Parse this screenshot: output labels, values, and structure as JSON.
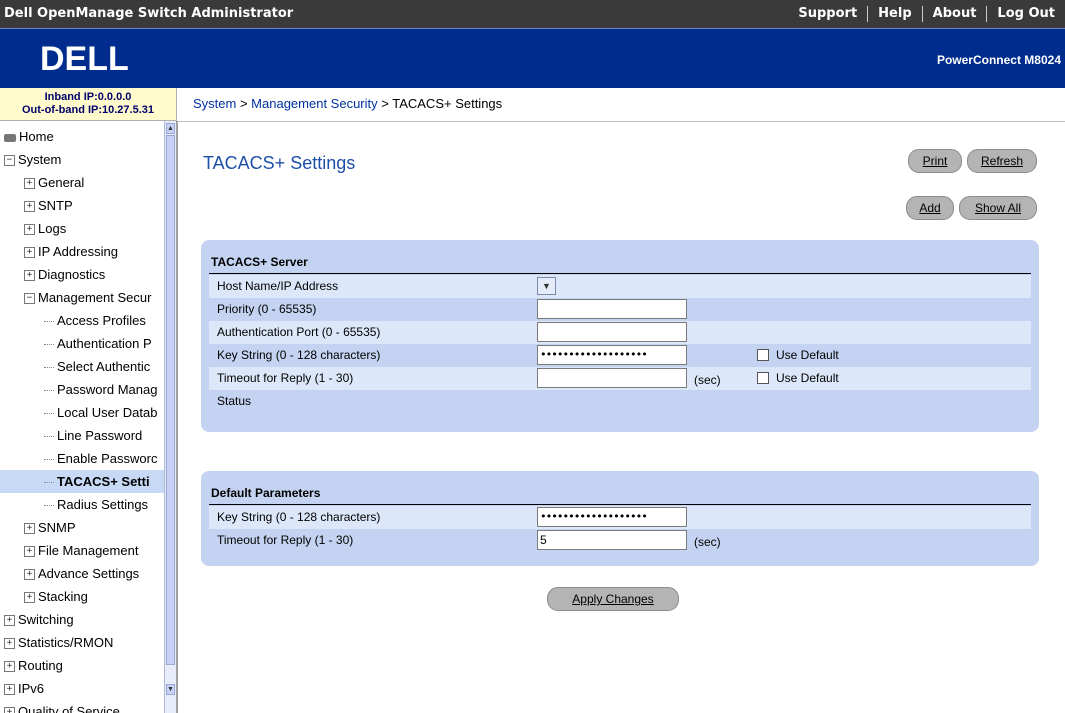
{
  "topbar": {
    "app_title": "Dell OpenManage Switch Administrator",
    "links": [
      "Support",
      "Help",
      "About",
      "Log Out"
    ]
  },
  "banner": {
    "logo_text": "DELL",
    "product": "PowerConnect M8024"
  },
  "ip_info": {
    "inband": "Inband IP:0.0.0.0",
    "out_of_band": "Out-of-band IP:10.27.5.31"
  },
  "breadcrumb": {
    "system": "System",
    "sep1": " > ",
    "mgmt": "Management Security",
    "sep2": " > ",
    "current": "TACACS+ Settings"
  },
  "sidebar": {
    "items": [
      {
        "label": "Home",
        "level": 0,
        "type": "home"
      },
      {
        "label": "System",
        "level": 0,
        "type": "minus"
      },
      {
        "label": "General",
        "level": 1,
        "type": "plus"
      },
      {
        "label": "SNTP",
        "level": 1,
        "type": "plus"
      },
      {
        "label": "Logs",
        "level": 1,
        "type": "plus"
      },
      {
        "label": "IP Addressing",
        "level": 1,
        "type": "plus"
      },
      {
        "label": "Diagnostics",
        "level": 1,
        "type": "plus"
      },
      {
        "label": "Management Secur",
        "level": 1,
        "type": "minus"
      },
      {
        "label": "Access Profiles",
        "level": 2,
        "type": "leaf"
      },
      {
        "label": "Authentication P",
        "level": 2,
        "type": "leaf"
      },
      {
        "label": "Select Authentic",
        "level": 2,
        "type": "leaf"
      },
      {
        "label": "Password Manag",
        "level": 2,
        "type": "leaf"
      },
      {
        "label": "Local User Datab",
        "level": 2,
        "type": "leaf"
      },
      {
        "label": "Line Password",
        "level": 2,
        "type": "leaf"
      },
      {
        "label": "Enable Passworc",
        "level": 2,
        "type": "leaf"
      },
      {
        "label": "TACACS+ Setti",
        "level": 2,
        "type": "leaf",
        "selected": true
      },
      {
        "label": "Radius Settings",
        "level": 2,
        "type": "leaf"
      },
      {
        "label": "SNMP",
        "level": 1,
        "type": "plus"
      },
      {
        "label": "File Management",
        "level": 1,
        "type": "plus"
      },
      {
        "label": "Advance Settings",
        "level": 1,
        "type": "plus"
      },
      {
        "label": "Stacking",
        "level": 1,
        "type": "plus"
      },
      {
        "label": "Switching",
        "level": 0,
        "type": "plus"
      },
      {
        "label": "Statistics/RMON",
        "level": 0,
        "type": "plus"
      },
      {
        "label": "Routing",
        "level": 0,
        "type": "plus"
      },
      {
        "label": "IPv6",
        "level": 0,
        "type": "plus"
      },
      {
        "label": "Quality of Service",
        "level": 0,
        "type": "plus"
      }
    ]
  },
  "page": {
    "title": "TACACS+ Settings",
    "buttons": {
      "print": "Print",
      "refresh": "Refresh",
      "add": "Add",
      "show_all": "Show All",
      "apply": "Apply Changes"
    }
  },
  "server_panel": {
    "title": "TACACS+ Server",
    "host_label": "Host Name/IP Address",
    "priority_label": "Priority (0 - 65535)",
    "priority_value": "",
    "port_label": "Authentication Port (0 - 65535)",
    "port_value": "",
    "key_label": "Key String (0 - 128 characters)",
    "key_value": "•••••••••••••••••••",
    "key_use_default": "Use Default",
    "timeout_label": "Timeout for Reply (1 - 30)",
    "timeout_value": "",
    "timeout_unit": "(sec)",
    "timeout_use_default": "Use Default",
    "status_label": "Status"
  },
  "default_panel": {
    "title": "Default Parameters",
    "key_label": "Key String (0 - 128 characters)",
    "key_value": "•••••••••••••••••••",
    "timeout_label": "Timeout for Reply (1 - 30)",
    "timeout_value": "5",
    "timeout_unit": "(sec)"
  },
  "colors": {
    "banner": "#002d8d",
    "panel": "#c4d3f1",
    "title": "#1e4fa8"
  }
}
